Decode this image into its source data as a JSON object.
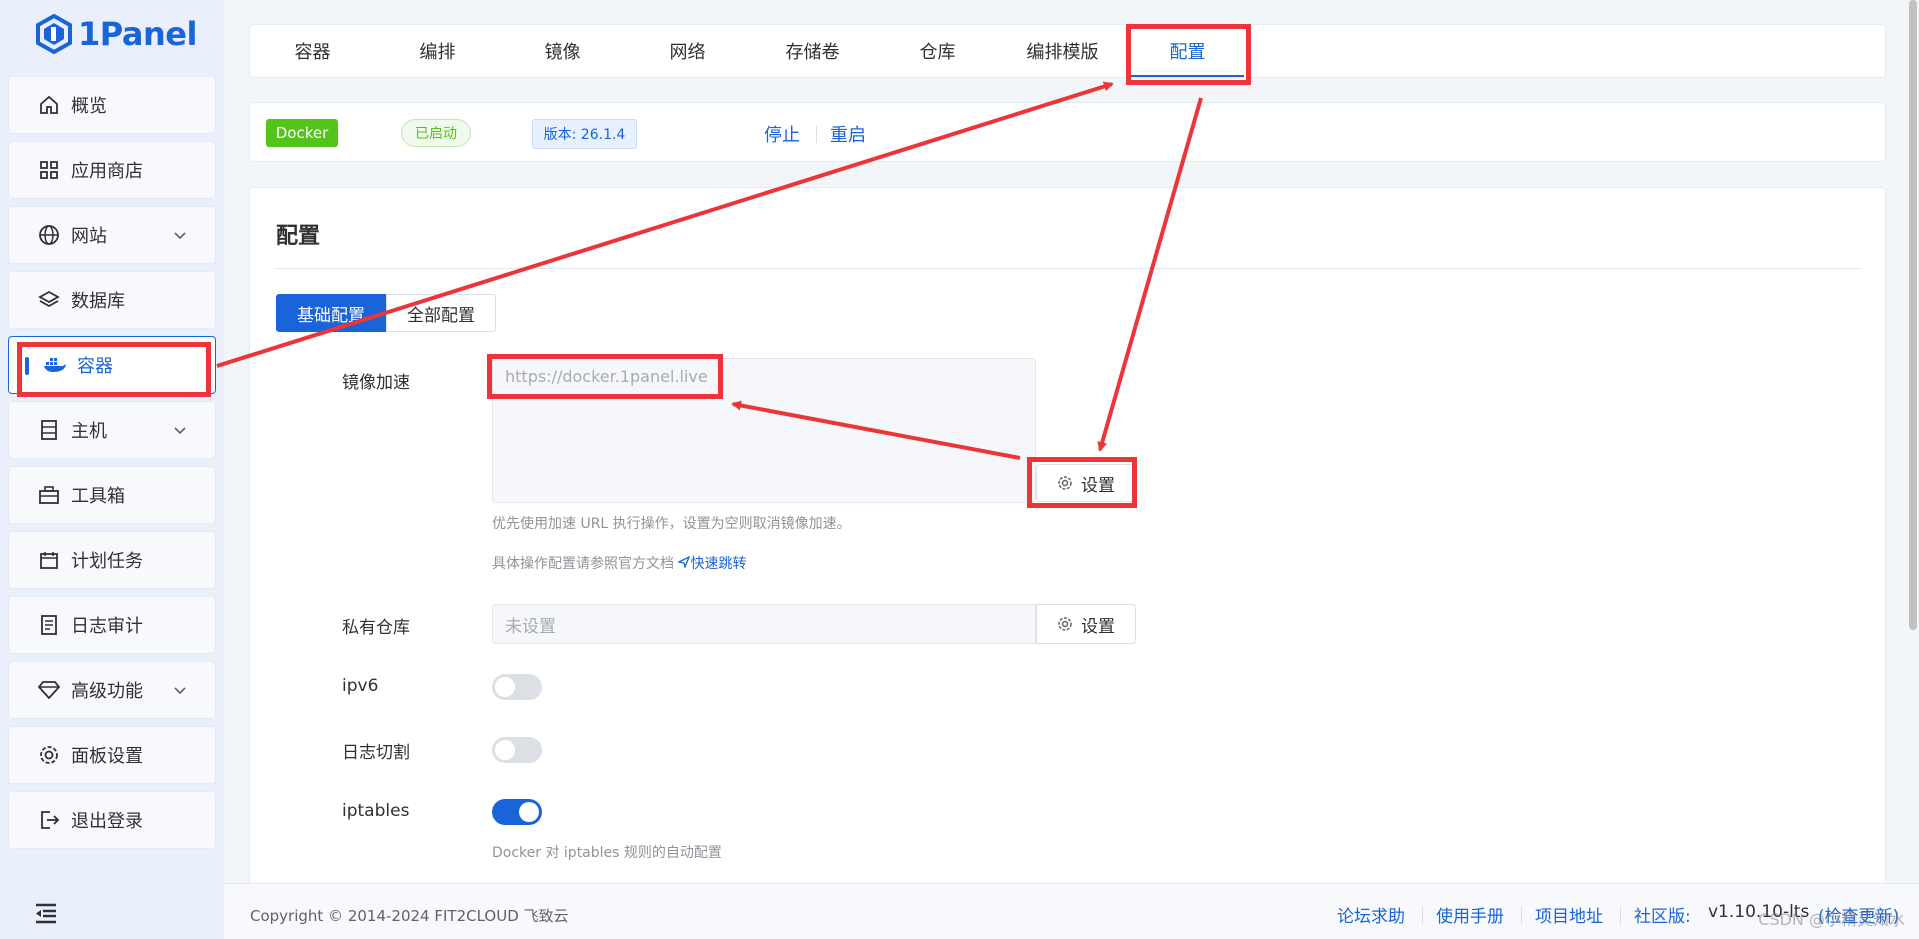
{
  "brand": {
    "name": "1Panel"
  },
  "sidebar": {
    "items": [
      {
        "label": "概览",
        "icon": "home-icon",
        "expandable": false
      },
      {
        "label": "应用商店",
        "icon": "grid-icon",
        "expandable": false
      },
      {
        "label": "网站",
        "icon": "globe-icon",
        "expandable": true
      },
      {
        "label": "数据库",
        "icon": "layers-icon",
        "expandable": false
      },
      {
        "label": "容器",
        "icon": "docker-icon",
        "expandable": false,
        "active": true
      },
      {
        "label": "主机",
        "icon": "server-icon",
        "expandable": true
      },
      {
        "label": "工具箱",
        "icon": "toolbox-icon",
        "expandable": false
      },
      {
        "label": "计划任务",
        "icon": "calendar-icon",
        "expandable": false
      },
      {
        "label": "日志审计",
        "icon": "document-icon",
        "expandable": false
      },
      {
        "label": "高级功能",
        "icon": "diamond-icon",
        "expandable": true
      },
      {
        "label": "面板设置",
        "icon": "gear-icon",
        "expandable": false
      },
      {
        "label": "退出登录",
        "icon": "logout-icon",
        "expandable": false
      }
    ]
  },
  "tabs": [
    {
      "label": "容器"
    },
    {
      "label": "编排"
    },
    {
      "label": "镜像"
    },
    {
      "label": "网络"
    },
    {
      "label": "存储卷"
    },
    {
      "label": "仓库"
    },
    {
      "label": "编排模版"
    },
    {
      "label": "配置",
      "active": true
    }
  ],
  "status": {
    "engine": "Docker",
    "state": "已启动",
    "version": "版本: 26.1.4",
    "stop": "停止",
    "restart": "重启"
  },
  "config": {
    "title": "配置",
    "mode_basic": "基础配置",
    "mode_all": "全部配置",
    "mirror": {
      "label": "镜像加速",
      "value": "https://docker.1panel.live",
      "set_label": "设置",
      "hint1": "优先使用加速 URL 执行操作，设置为空则取消镜像加速。",
      "hint2": "具体操作配置请参照官方文档",
      "jump": "快速跳转"
    },
    "private_repo": {
      "label": "私有仓库",
      "placeholder": "未设置",
      "set_label": "设置"
    },
    "ipv6": {
      "label": "ipv6",
      "enabled": false
    },
    "log_cut": {
      "label": "日志切割",
      "enabled": false
    },
    "iptables": {
      "label": "iptables",
      "enabled": true,
      "hint": "Docker 对 iptables 规则的自动配置"
    }
  },
  "footer": {
    "copyright": "Copyright © 2014-2024 FIT2CLOUD 飞致云",
    "links": [
      "论坛求助",
      "使用手册",
      "项目地址"
    ],
    "edition": "社区版:",
    "version": "v1.10.10-lts",
    "check_update": "(检查更新)",
    "watermark": "CSDN @小精灵知水"
  },
  "colors": {
    "accent": "#1a64d9",
    "success": "#52c41a",
    "annotation": "#ec3538"
  }
}
